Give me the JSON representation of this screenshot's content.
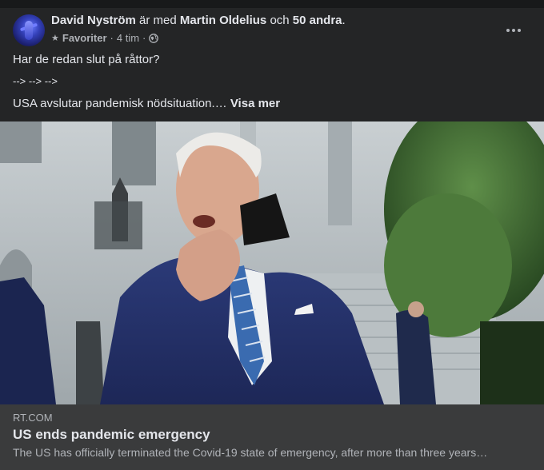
{
  "post": {
    "author": "David Nyström",
    "with_text": "är med",
    "tagged": "Martin Oldelius",
    "and_text": "och",
    "others": "50 andra",
    "period": ".",
    "audience": "Favoriter",
    "time": "4 tim",
    "sep": "·",
    "body_line1": "Har de redan slut på råttor?",
    "body_line2": "--> --> -->",
    "body_line3": "USA avslutar pandemisk nödsituation.…",
    "see_more": "Visa mer"
  },
  "link": {
    "domain": "RT.COM",
    "title": "US ends pandemic emergency",
    "description": "The US has officially terminated the Covid-19 state of emergency, after more than three years…"
  },
  "icons": [
    "star-icon",
    "globe-icon",
    "more-options-icon"
  ],
  "colors": {
    "background": "#242526",
    "caption_bg": "#3a3b3c",
    "text": "#e4e6eb",
    "muted": "#b0b3b8"
  }
}
